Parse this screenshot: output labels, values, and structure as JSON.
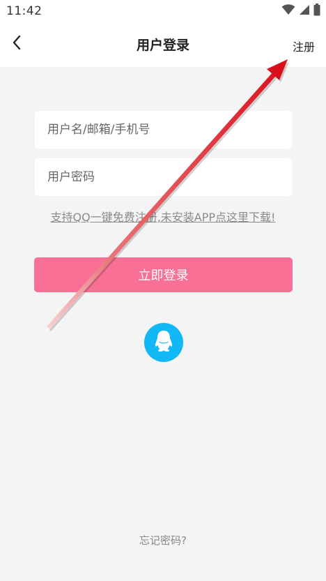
{
  "status_bar": {
    "time": "11:42",
    "icons": [
      "wifi-icon",
      "signal-icon",
      "battery-icon"
    ]
  },
  "header": {
    "back_icon": "chevron-left-icon",
    "title": "用户登录",
    "register_label": "注册"
  },
  "form": {
    "username_placeholder": "用户名/邮箱/手机号",
    "username_value": "",
    "password_placeholder": "用户密码",
    "password_value": "",
    "qq_hint": "支持QQ一键免费注册,未安装APP点这里下载!",
    "login_label": "立即登录",
    "qq_icon": "qq-penguin-icon",
    "forgot_label": "忘记密码?"
  },
  "colors": {
    "login_button": "#f87095",
    "qq_button": "#12b7f5",
    "annotation_arrow": "#e0151f"
  }
}
